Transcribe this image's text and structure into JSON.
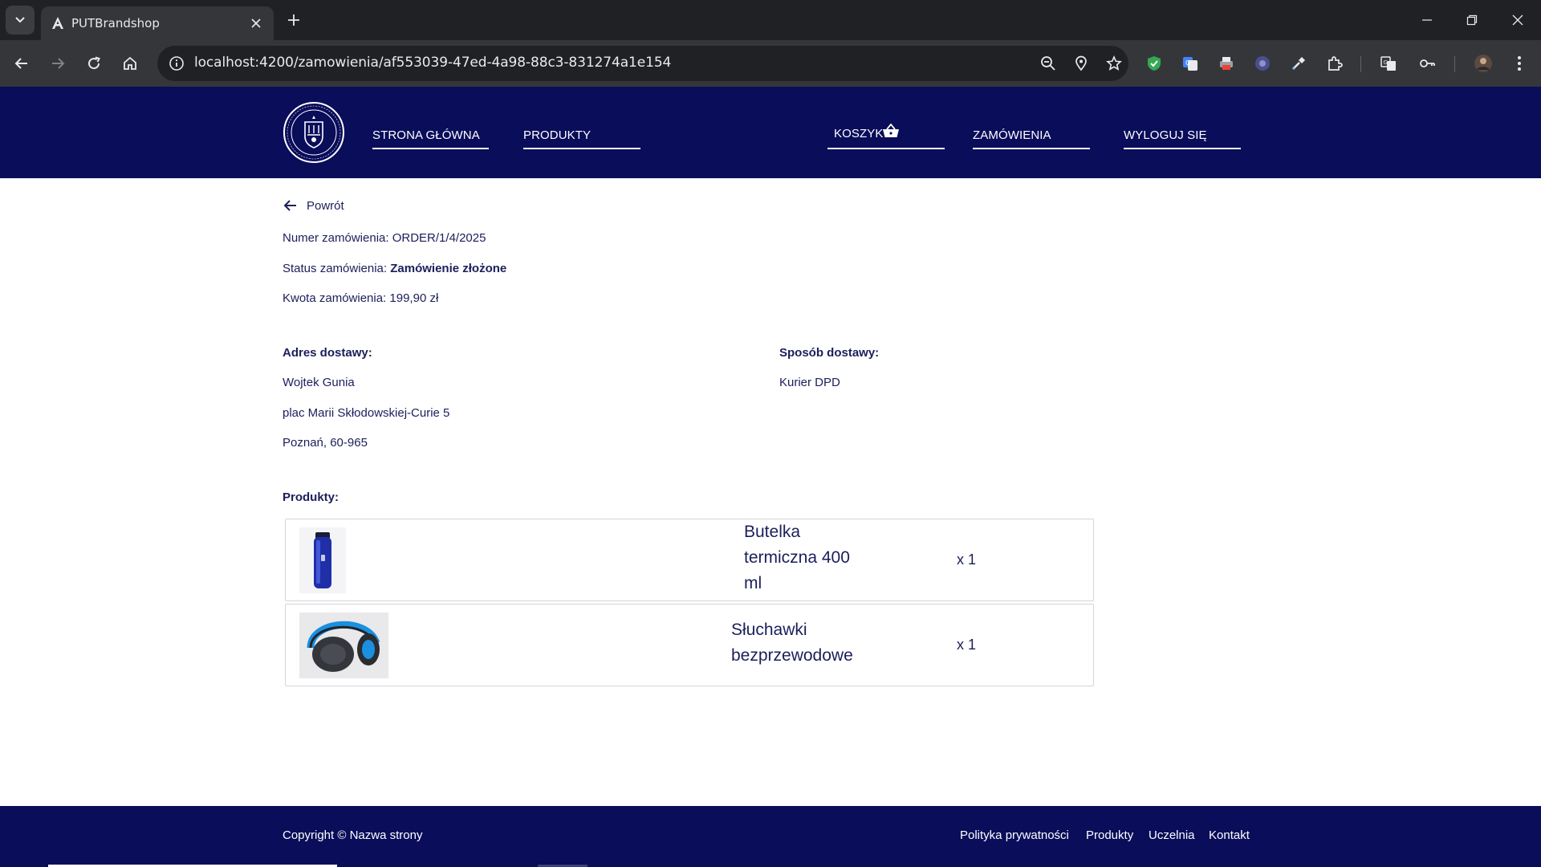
{
  "browser": {
    "tab_title": "PUTBrandshop",
    "url": "localhost:4200/zamowienia/af553039-47ed-4a98-88c3-831274a1e154"
  },
  "header": {
    "logo_alt": "Politechnika Poznańska",
    "nav": {
      "home": "STRONA GŁÓWNA",
      "products": "PRODUKTY",
      "cart": "KOSZYK",
      "orders": "ZAMÓWIENIA",
      "logout": "WYLOGUJ SIĘ"
    }
  },
  "order": {
    "back_label": "Powrót",
    "number_label": "Numer zamówienia: ",
    "number_value": "ORDER/1/4/2025",
    "status_label": "Status zamówienia: ",
    "status_value": "Zamówienie złożone",
    "amount_label": "Kwota zamówienia: ",
    "amount_value": "199,90 zł",
    "address": {
      "title": "Adres dostawy:",
      "name": "Wojtek Gunia",
      "street": "plac Marii Skłodowskiej-Curie 5",
      "city": "Poznań, 60-965"
    },
    "delivery": {
      "title": "Sposób dostawy:",
      "method": "Kurier DPD"
    },
    "products_title": "Produkty:",
    "products": [
      {
        "name_lines": [
          "Butelka",
          "termiczna 400",
          "ml"
        ],
        "quantity": "x 1",
        "image": "thermal-bottle"
      },
      {
        "name_lines": [
          "Słuchawki",
          "bezprzewodowe"
        ],
        "quantity": "x 1",
        "image": "wireless-headphones"
      }
    ]
  },
  "footer": {
    "copyright": "Copyright © Nazwa strony",
    "links": [
      "Polityka prywatności",
      "Produkty",
      "Uczelnia",
      "Kontakt"
    ]
  },
  "colors": {
    "brand_navy": "#0a0d5a",
    "text_navy": "#1b1f5a",
    "chrome_dark": "#202124",
    "chrome_toolbar": "#35363a"
  }
}
